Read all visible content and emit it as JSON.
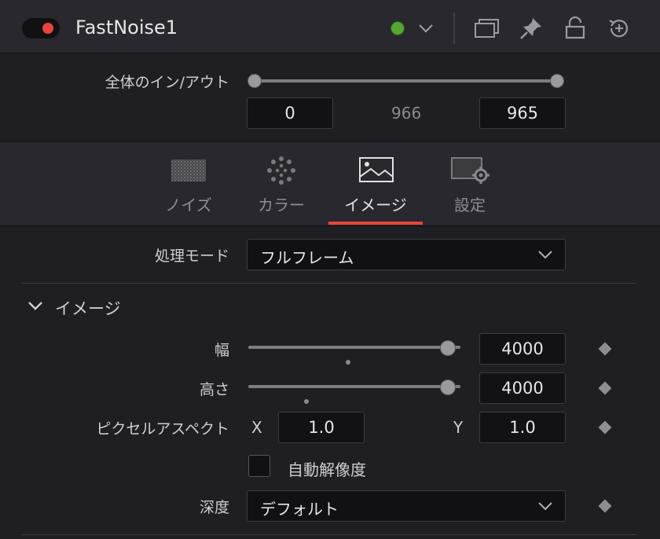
{
  "header": {
    "node_name": "FastNoise1",
    "toggle_color": "#e8453c",
    "status_color": "#57a532",
    "icons": [
      "chevron-down-icon",
      "window-icon",
      "pin-icon",
      "lock-icon",
      "reset-icon"
    ]
  },
  "global_range": {
    "label": "全体のイン/アウト",
    "in_value": "0",
    "duration": "966",
    "out_value": "965"
  },
  "tabs": [
    {
      "label": "ノイズ",
      "icon": "noise-icon"
    },
    {
      "label": "カラー",
      "icon": "color-icon"
    },
    {
      "label": "イメージ",
      "icon": "image-icon",
      "active": true
    },
    {
      "label": "設定",
      "icon": "settings-icon"
    }
  ],
  "accent_color": "#e8453c",
  "process_mode": {
    "label": "処理モード",
    "value": "フルフレーム"
  },
  "image_section": {
    "title": "イメージ",
    "width": {
      "label": "幅",
      "value": "4000",
      "slider_fraction": 0.94
    },
    "height": {
      "label": "高さ",
      "value": "4000",
      "slider_fraction": 0.94
    },
    "pixel_aspect": {
      "label": "ピクセルアスペクト",
      "x_label": "X",
      "x_value": "1.0",
      "y_label": "Y",
      "y_value": "1.0"
    },
    "auto_resolution": {
      "label": "自動解像度",
      "checked": false
    },
    "depth": {
      "label": "深度",
      "value": "デフォルト"
    }
  }
}
